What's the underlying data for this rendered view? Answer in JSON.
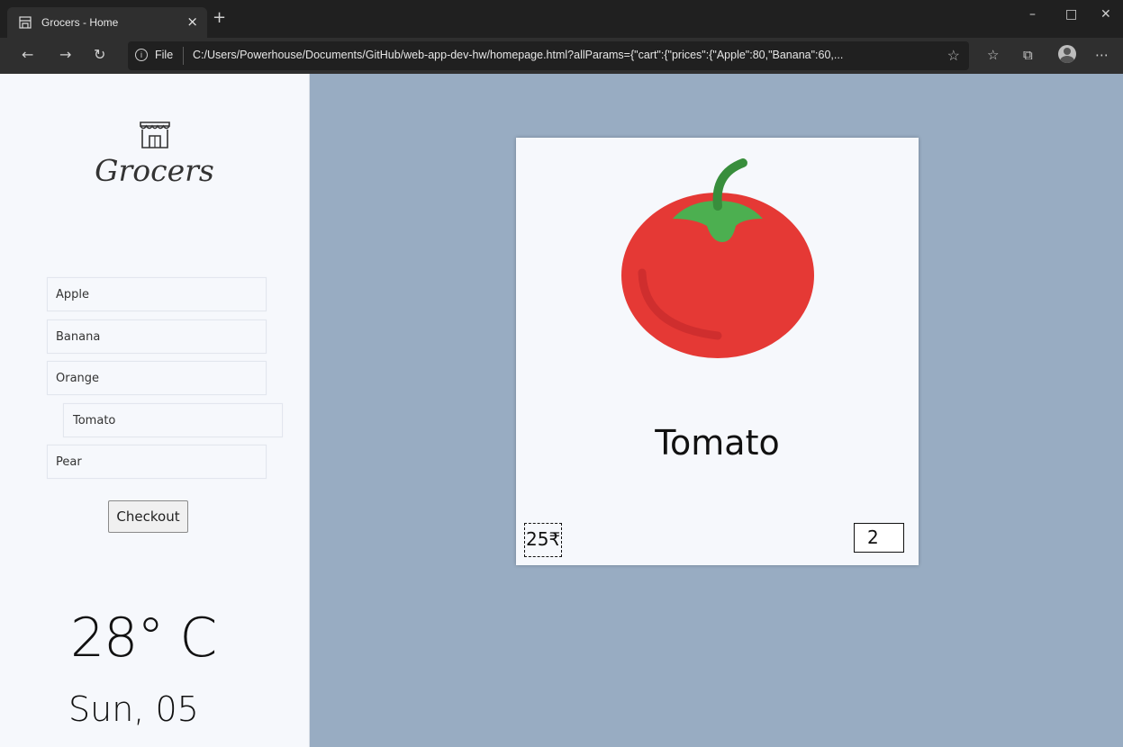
{
  "browser": {
    "tab_title": "Grocers - Home",
    "tab_close": "×",
    "new_tab": "+",
    "file_label": "File",
    "url": "C:/Users/Powerhouse/Documents/GitHub/web-app-dev-hw/homepage.html?allParams={\"cart\":{\"prices\":{\"Apple\":80,\"Banana\":60,..."
  },
  "app": {
    "logo_text": "Grocers",
    "products": [
      {
        "label": "Apple"
      },
      {
        "label": "Banana"
      },
      {
        "label": "Orange"
      },
      {
        "label": "Tomato"
      },
      {
        "label": "Pear"
      }
    ],
    "selected_product": "Tomato",
    "checkout_label": "Checkout",
    "weather": {
      "temperature": "28° C",
      "date": "Sun, 05"
    },
    "card": {
      "name": "Tomato",
      "price": "25₹",
      "quantity": "2"
    }
  },
  "colors": {
    "page_background": "#98acc2",
    "sidebar_background": "#f6f8fc",
    "tomato_red": "#e53935",
    "tomato_leaf": "#4caf50"
  },
  "icons": {
    "logo": "storefront-icon",
    "tab_favicon": "storefront-icon"
  }
}
